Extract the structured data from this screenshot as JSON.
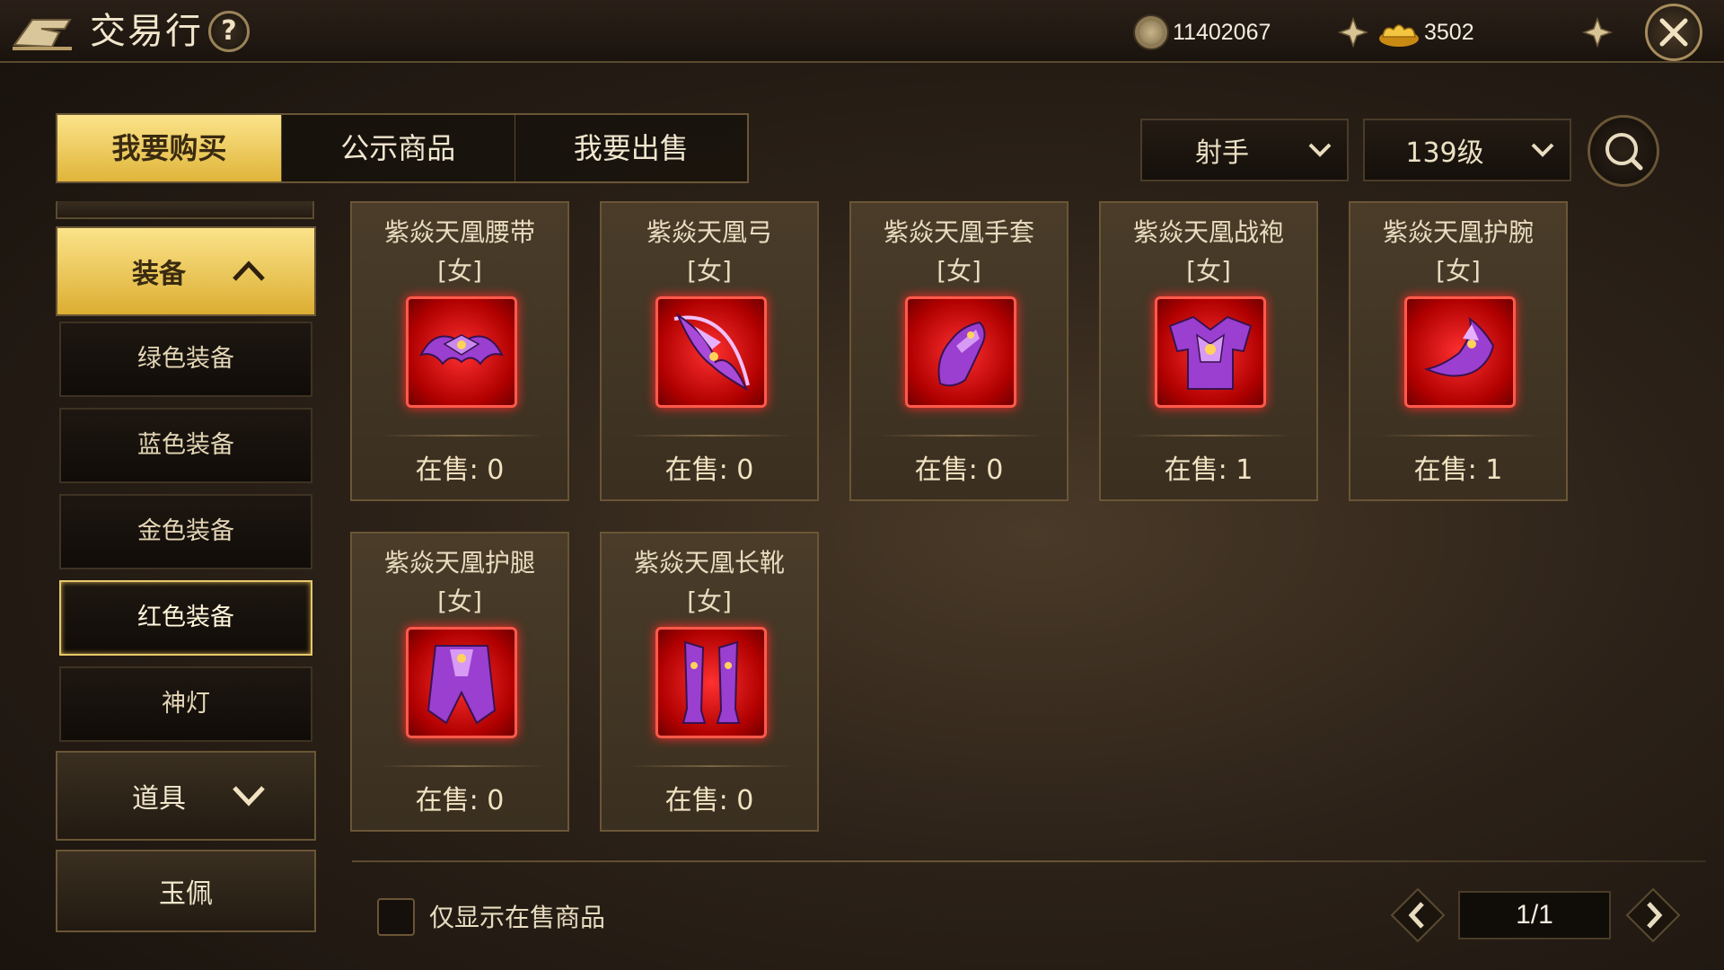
{
  "header": {
    "title": "交易行",
    "help_label": "?",
    "coins": "11402067",
    "ingots": "3502"
  },
  "tabs": [
    {
      "label": "我要购买",
      "active": true
    },
    {
      "label": "公示商品",
      "active": false
    },
    {
      "label": "我要出售",
      "active": false
    }
  ],
  "filters": {
    "class_label": "射手",
    "level_label": "139级"
  },
  "sidebar": {
    "category_equipment": "装备",
    "sub_items": [
      "绿色装备",
      "蓝色装备",
      "金色装备",
      "红色装备",
      "神灯"
    ],
    "active_sub": "红色装备",
    "category_props": "道具",
    "category_jade": "玉佩"
  },
  "items": [
    {
      "name": "紫焱天凰腰带",
      "gender": "[女]",
      "stock": "在售: 0",
      "icon": "belt-icon"
    },
    {
      "name": "紫焱天凰弓",
      "gender": "[女]",
      "stock": "在售: 0",
      "icon": "bow-icon"
    },
    {
      "name": "紫焱天凰手套",
      "gender": "[女]",
      "stock": "在售: 0",
      "icon": "gloves-icon"
    },
    {
      "name": "紫焱天凰战袍",
      "gender": "[女]",
      "stock": "在售: 1",
      "icon": "armor-icon"
    },
    {
      "name": "紫焱天凰护腕",
      "gender": "[女]",
      "stock": "在售: 1",
      "icon": "bracer-icon"
    },
    {
      "name": "紫焱天凰护腿",
      "gender": "[女]",
      "stock": "在售: 0",
      "icon": "leg-guard-icon"
    },
    {
      "name": "紫焱天凰长靴",
      "gender": "[女]",
      "stock": "在售: 0",
      "icon": "boots-icon"
    }
  ],
  "footer": {
    "only_on_sale_label": "仅显示在售商品",
    "page": "1/1"
  },
  "colors": {
    "accent_gold": "#f0c94a",
    "item_red": "#e01010",
    "item_purple": "#9a3fd0"
  }
}
